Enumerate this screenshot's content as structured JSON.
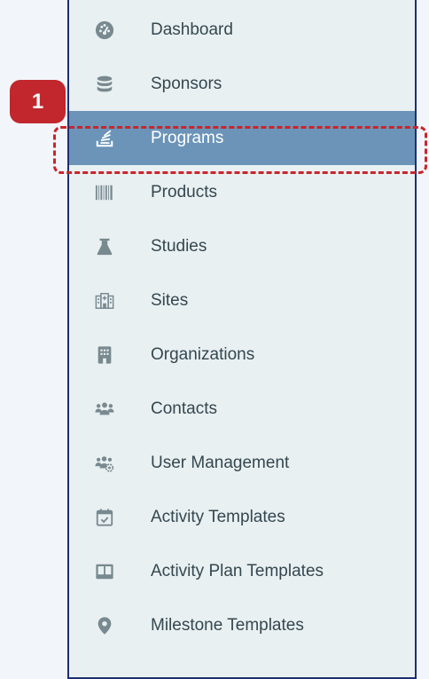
{
  "colors": {
    "sidebar_bg": "#e9f0f2",
    "sidebar_border": "#1c2f73",
    "active_bg": "#6b94b8",
    "icon": "#78898f",
    "text": "#34474f",
    "highlight": "#c9252c",
    "badge": "#c1272d"
  },
  "annotation": {
    "step_number": "1"
  },
  "nav": {
    "items": [
      {
        "label": "Dashboard",
        "icon": "dashboard-icon"
      },
      {
        "label": "Sponsors",
        "icon": "database-icon"
      },
      {
        "label": "Programs",
        "icon": "stack-icon",
        "active": true
      },
      {
        "label": "Products",
        "icon": "barcode-icon"
      },
      {
        "label": "Studies",
        "icon": "flask-icon"
      },
      {
        "label": "Sites",
        "icon": "hospital-building-icon"
      },
      {
        "label": "Organizations",
        "icon": "building-icon"
      },
      {
        "label": "Contacts",
        "icon": "users-icon"
      },
      {
        "label": "User Management",
        "icon": "users-gear-icon"
      },
      {
        "label": "Activity Templates",
        "icon": "calendar-check-icon"
      },
      {
        "label": "Activity Plan Templates",
        "icon": "book-open-icon"
      },
      {
        "label": "Milestone Templates",
        "icon": "map-pin-icon"
      }
    ]
  }
}
